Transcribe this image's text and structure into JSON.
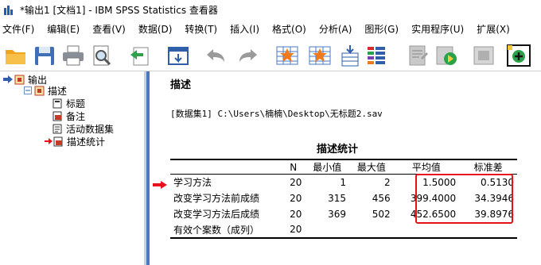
{
  "window": {
    "title": "*输出1 [文档1] - IBM SPSS Statistics 查看器"
  },
  "menu": [
    "文件(F)",
    "编辑(E)",
    "查看(V)",
    "数据(D)",
    "转换(T)",
    "插入(I)",
    "格式(O)",
    "分析(A)",
    "图形(G)",
    "实用程序(U)",
    "扩展(X)"
  ],
  "toolbar": {
    "icons": [
      "open-folder-icon",
      "save-icon",
      "print-icon",
      "print-preview-icon",
      "export-icon",
      "recall-dialog-icon",
      "undo-icon",
      "redo-icon",
      "goto-data-icon",
      "goto-case-icon",
      "variables-icon",
      "insert-heading-icon",
      "insert-title-icon",
      "show-all-icon",
      "hide-icon",
      "insert-item-icon"
    ]
  },
  "tree": {
    "root": "输出",
    "group": "描述",
    "children": [
      "标题",
      "备注",
      "活动数据集",
      "描述统计"
    ]
  },
  "output": {
    "heading": "描述",
    "dataset_line": "[数据集1]  C:\\Users\\楠楠\\Desktop\\无标题2.sav",
    "table_title": "描述统计",
    "columns": [
      "",
      "N",
      "最小值",
      "最大值",
      "平均值",
      "标准差"
    ],
    "rows": [
      [
        "学习方法",
        "20",
        "1",
        "2",
        "1.5000",
        "0.5130"
      ],
      [
        "改变学习方法前成绩",
        "20",
        "315",
        "456",
        "399.4000",
        "34.3946"
      ],
      [
        "改变学习方法后成绩",
        "20",
        "369",
        "502",
        "452.6500",
        "39.8976"
      ],
      [
        "有效个案数（成列）",
        "20",
        "",
        "",
        "",
        ""
      ]
    ]
  },
  "colors": {
    "highlight": "#e8101a",
    "divider": "#4a79c0"
  }
}
